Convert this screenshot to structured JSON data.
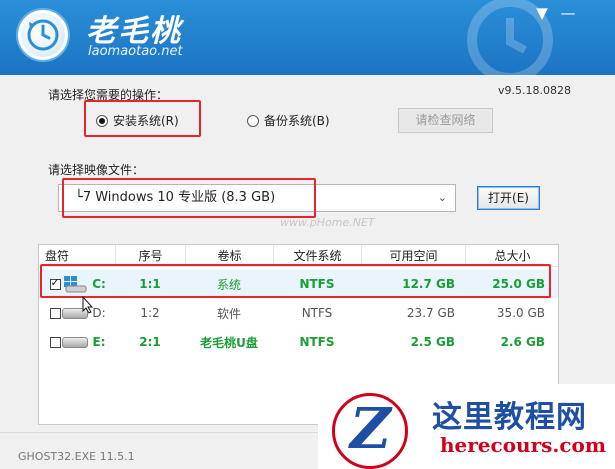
{
  "header": {
    "brand_cn": "老毛桃",
    "brand_en": "laomaotao.net",
    "menu_icon": "chevron-down-icon",
    "minimize_icon": "minimize-icon"
  },
  "version": "v9.5.18.0828",
  "operation": {
    "label": "请选择您需要的操作：",
    "install_label": "安装系统(R)",
    "install_selected": true,
    "backup_label": "备份系统(B)",
    "backup_selected": false,
    "network_button": "请检查网络"
  },
  "image": {
    "label": "请选择映像文件：",
    "selected": "└7 Windows 10 专业版 (8.3 GB)",
    "open_button": "打开(E)",
    "watermark": "www.pHome.NET"
  },
  "table": {
    "headers": [
      "盘符",
      "序号",
      "卷标",
      "文件系统",
      "可用空间",
      "总大小"
    ],
    "rows": [
      {
        "checked": true,
        "drive": "C:",
        "index": "1:1",
        "label": "系统",
        "fs": "NTFS",
        "free": "12.7 GB",
        "total": "25.0 GB",
        "color": "#1a9e34"
      },
      {
        "checked": false,
        "drive": "D:",
        "index": "1:2",
        "label": "软件",
        "fs": "NTFS",
        "free": "23.7 GB",
        "total": "35.0 GB",
        "color": "#555555"
      },
      {
        "checked": false,
        "drive": "E:",
        "index": "2:1",
        "label": "老毛桃U盘",
        "fs": "NTFS",
        "free": "2.5 GB",
        "total": "2.6 GB",
        "color": "#1a9e34"
      }
    ]
  },
  "footer": {
    "ghost": "GHOST32.EXE 11.5.1"
  },
  "site_watermark": {
    "cn": "这里教程网",
    "en": "herecours.com",
    "letter": "Z"
  },
  "colors": {
    "header_blue": "#1c74c4",
    "highlight_red": "#e8242b",
    "drive_green": "#1a9e34"
  }
}
